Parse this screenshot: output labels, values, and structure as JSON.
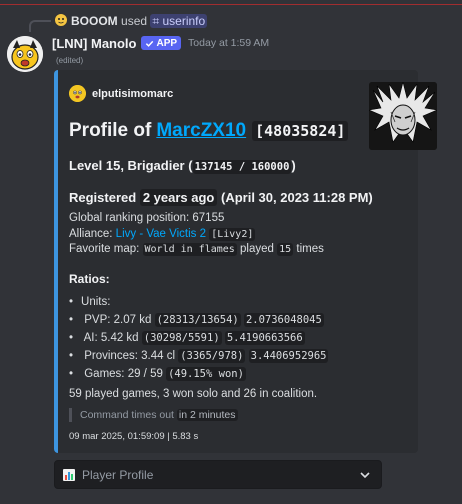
{
  "reply": {
    "user": "BOOOM",
    "action": "used",
    "command": "userinfo"
  },
  "message": {
    "username": "[LNN] Manolo",
    "badge": "APP",
    "timestamp": "Today at 1:59 AM",
    "edited": "(edited)"
  },
  "embed": {
    "author": "elputisimomarc",
    "title_prefix": "Profile of",
    "title_link": "MarcZX10",
    "player_id": "[48035824]",
    "level_text": "Level 15, Brigadier (",
    "level_xp": "137145 / 160000",
    "level_close": ")",
    "registered_label": "Registered",
    "registered_ago": "2 years ago",
    "registered_date": "(April 30, 2023 11:28 PM)",
    "global_ranking": "Global ranking position: 67155",
    "alliance_label": "Alliance:",
    "alliance_name": "Livy - Vae Victis 2",
    "alliance_tag": "[Livy2]",
    "fav_map_label": "Favorite map:",
    "fav_map_name": "World in flames",
    "fav_map_played": "played",
    "fav_map_count": "15",
    "fav_map_times": "times",
    "ratios_heading": "Ratios:",
    "units_label": "Units:",
    "pvp_label": "PVP: 2.07 kd",
    "pvp_raw": "(28313/13654)",
    "pvp_exact": "2.0736048045",
    "ai_label": "AI: 5.42 kd",
    "ai_raw": "(30298/5591)",
    "ai_exact": "5.4190663566",
    "prov_label": "Provinces: 3.44 cl",
    "prov_raw": "(3365/978)",
    "prov_exact": "3.4406952965",
    "games_label": "Games: 29 / 59",
    "games_pct": "(49.15% won)",
    "played_summary": "59 played games, 3 won solo and 26 in coalition.",
    "timeout_text": "Command times out",
    "timeout_value": "in 2 minutes",
    "footer": "09 mar 2025, 01:59:09 | 5.83 s"
  },
  "select": {
    "label": "Player Profile"
  },
  "colors": {
    "background": "#313338",
    "embed_bg": "#2b2d31",
    "embed_border": "#3d95e0",
    "link": "#00a8fc",
    "app_badge": "#5865f2"
  }
}
